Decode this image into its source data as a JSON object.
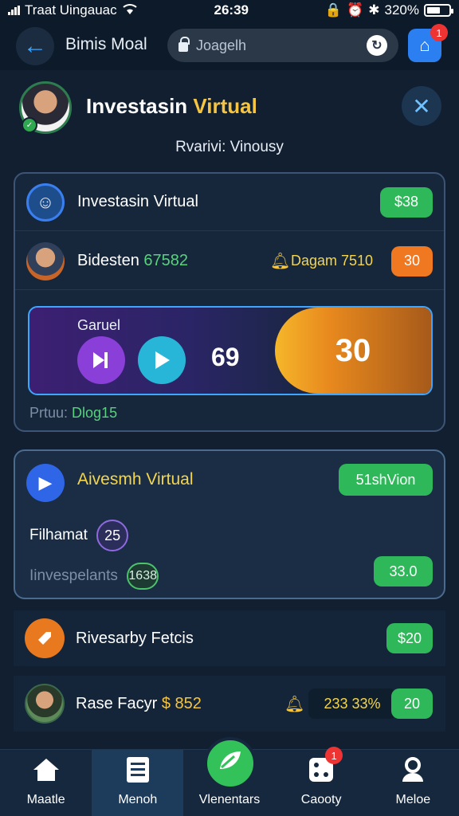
{
  "status": {
    "carrier": "Traat Uingauac",
    "time": "26:39",
    "battery": "320%"
  },
  "nav": {
    "title": "Bimis Moal",
    "search_text": "Joagelh",
    "app_badge": "1"
  },
  "header": {
    "title_a": "Investasin",
    "title_b": "Virtual",
    "subtitle": "Rvarivi: Vinousy"
  },
  "card1": {
    "row1": {
      "label": "Investasin Virtual",
      "pill": "$38"
    },
    "row2": {
      "label": "Bidesten",
      "value": "67582",
      "alert": "Dagam 7510",
      "pill": "30"
    },
    "promo": {
      "label": "Garuel",
      "number": "69",
      "big": "30"
    },
    "footer_label": "Prtuu:",
    "footer_value": "Dlog15"
  },
  "card2": {
    "title": "Aivesmh Virtual",
    "button": "51shVion",
    "line1": "Filhamat",
    "chip1": "25",
    "line2": "Iinvespelants",
    "chip2": "1638",
    "pill": "33.0"
  },
  "list": [
    {
      "label": "Rivesarby Fetcis",
      "pill": "$20"
    },
    {
      "label": "Rase Facyr",
      "amount": "$ 852",
      "alert": "233 33%",
      "pill": "20"
    }
  ],
  "tabs": [
    {
      "label": "Maatle"
    },
    {
      "label": "Menoh"
    },
    {
      "label": "Vlenentars"
    },
    {
      "label": "Caooty",
      "badge": "1"
    },
    {
      "label": "Meloe"
    }
  ]
}
